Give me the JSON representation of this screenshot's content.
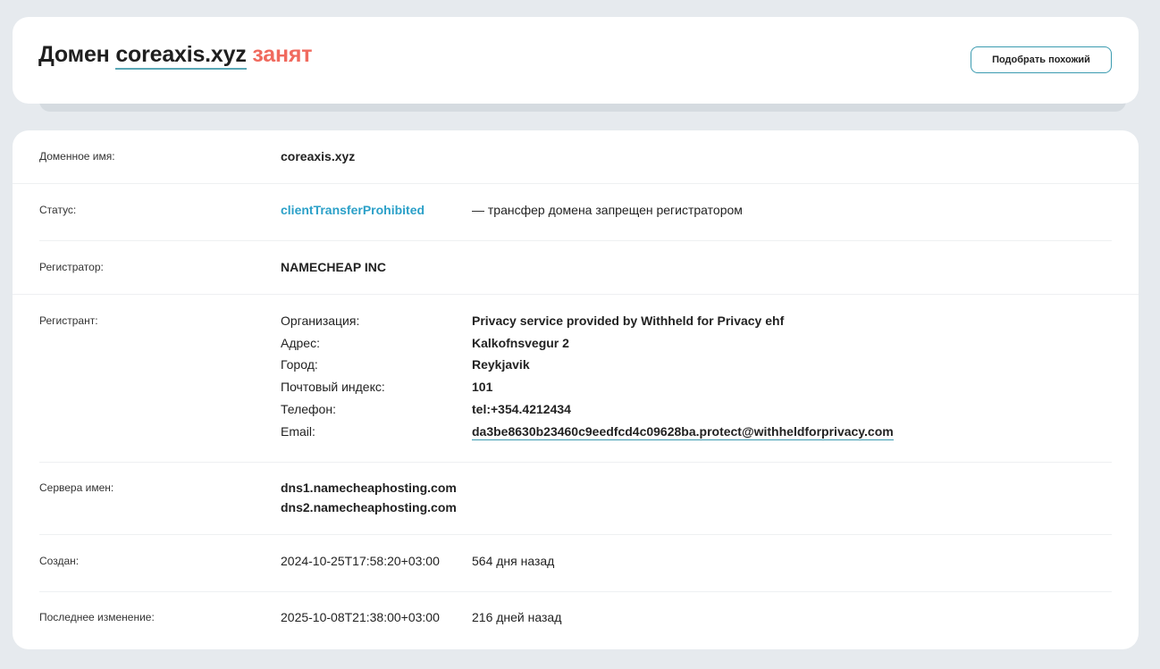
{
  "header": {
    "prefix": "Домен",
    "domain": "coreaxis.xyz",
    "status_word": "занят",
    "suggest_button": "Подобрать похожий"
  },
  "whois": {
    "domain_name": {
      "label": "Доменное имя:",
      "value": "coreaxis.xyz"
    },
    "status": {
      "label": "Статус:",
      "code": "clientTransferProhibited",
      "description": "— трансфер домена запрещен регистратором"
    },
    "registrar": {
      "label": "Регистратор:",
      "value": "NAMECHEAP INC"
    },
    "registrant": {
      "label": "Регистрант:",
      "fields": [
        {
          "label": "Организация:",
          "value": "Privacy service provided by Withheld for Privacy ehf"
        },
        {
          "label": "Адрес:",
          "value": "Kalkofnsvegur 2"
        },
        {
          "label": "Город:",
          "value": "Reykjavik"
        },
        {
          "label": "Почтовый индекс:",
          "value": "101"
        },
        {
          "label": "Телефон:",
          "value": "tel:+354.4212434"
        },
        {
          "label": "Email:",
          "value": "da3be8630b23460c9eedfcd4c09628ba.protect@withheldforprivacy.com"
        }
      ]
    },
    "nameservers": {
      "label": "Сервера имен:",
      "values": [
        "dns1.namecheaphosting.com",
        "dns2.namecheaphosting.com"
      ]
    },
    "created": {
      "label": "Создан:",
      "date": "2024-10-25T17:58:20+03:00",
      "ago": "564 дня назад"
    },
    "updated": {
      "label": "Последнее изменение:",
      "date": "2025-10-08T21:38:00+03:00",
      "ago": "216 дней назад"
    }
  },
  "colors": {
    "background": "#e6eaee",
    "busy": "#f06a5e",
    "accent": "#3b9bb0",
    "status_link": "#2ba0c8"
  }
}
